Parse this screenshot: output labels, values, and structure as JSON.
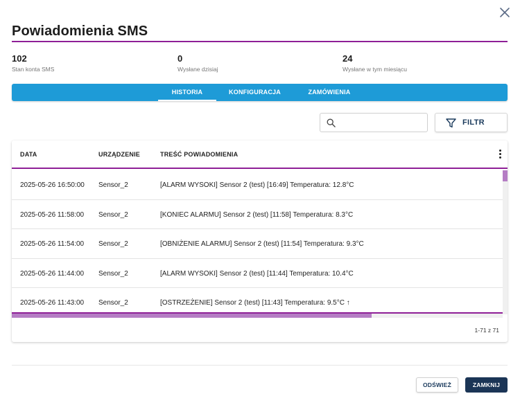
{
  "dialog": {
    "title": "Powiadomienia SMS",
    "close_icon": "close-icon"
  },
  "stats": [
    {
      "value": "102",
      "label": "Stan konta SMS"
    },
    {
      "value": "0",
      "label": "Wysłane dzisiaj"
    },
    {
      "value": "24",
      "label": "Wysłane w tym miesiącu"
    }
  ],
  "tabs": [
    {
      "label": "HISTORIA",
      "active": true
    },
    {
      "label": "KONFIGURACJA",
      "active": false
    },
    {
      "label": "ZAMÓWIENIA",
      "active": false
    }
  ],
  "colors": {
    "accent": "#8e1e96",
    "tab_bar": "#1e9bd7",
    "primary_button": "#1b3556"
  },
  "toolbar": {
    "search_placeholder": "",
    "search_value": "",
    "search_icon": "search-icon",
    "filter_icon": "filter-icon",
    "filter_label": "FILTR"
  },
  "table": {
    "columns": [
      "DATA",
      "URZĄDZENIE",
      "TREŚĆ POWIADOMIENIA"
    ],
    "rows": [
      {
        "date": "2025-05-26 16:50:00",
        "device": "Sensor_2",
        "content": "[ALARM WYSOKI] Sensor 2 (test) [16:49] Temperatura: 12.8°C"
      },
      {
        "date": "2025-05-26 11:58:00",
        "device": "Sensor_2",
        "content": "[KONIEC ALARMU] Sensor 2 (test) [11:58] Temperatura: 8.3°C"
      },
      {
        "date": "2025-05-26 11:54:00",
        "device": "Sensor_2",
        "content": "[OBNIŻENIE ALARMU] Sensor 2 (test) [11:54] Temperatura: 9.3°C"
      },
      {
        "date": "2025-05-26 11:44:00",
        "device": "Sensor_2",
        "content": "[ALARM WYSOKI] Sensor 2 (test) [11:44] Temperatura: 10.4°C"
      },
      {
        "date": "2025-05-26 11:43:00",
        "device": "Sensor_2",
        "content": "[OSTRZEŻENIE] Sensor 2 (test) [11:43] Temperatura: 9.5°C ↑"
      }
    ],
    "pagination": "1-71 z 71",
    "menu_icon": "more-vertical-icon"
  },
  "footer": {
    "refresh_label": "ODŚWIEŻ",
    "close_label": "ZAMKNIJ"
  }
}
